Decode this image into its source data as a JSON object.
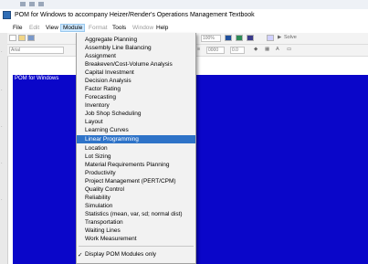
{
  "window": {
    "title": "POM for Windows to accompany Heizer/Render's Operations Management Textbook"
  },
  "menubar": {
    "items": [
      {
        "label": "File",
        "state": "normal"
      },
      {
        "label": "Edit",
        "state": "disabled"
      },
      {
        "label": "View",
        "state": "normal"
      },
      {
        "label": "Module",
        "state": "active"
      },
      {
        "label": "Format",
        "state": "disabled"
      },
      {
        "label": "Tools",
        "state": "normal"
      },
      {
        "label": "Window",
        "state": "disabled"
      },
      {
        "label": "Help",
        "state": "normal"
      }
    ]
  },
  "toolbar": {
    "font_field": "Arial",
    "zoom": "100%",
    "number_format": "0000",
    "decimal": "0.0",
    "solve_label": "Solve"
  },
  "child_window": {
    "title": "POM for Windows"
  },
  "module_menu": {
    "items": [
      "Aggregate Planning",
      "Assembly Line Balancing",
      "Assignment",
      "Breakeven/Cost-Volume Analysis",
      "Capital Investment",
      "Decision Analysis",
      "Factor Rating",
      "Forecasting",
      "Inventory",
      "Job Shop Scheduling",
      "Layout",
      "Learning Curves",
      "Linear Programming",
      "Location",
      "Lot Sizing",
      "Material Requirements Planning",
      "Productivity",
      "Project Management (PERT/CPM)",
      "Quality Control",
      "Reliability",
      "Simulation",
      "Statistics (mean, var, sd; normal dist)",
      "Transportation",
      "Waiting Lines",
      "Work Measurement"
    ],
    "highlighted": "Linear Programming",
    "footer_item": "Display POM Modules only",
    "footer_checked": true
  },
  "colors": {
    "highlight": "#2e73c8",
    "workspace": "#0a06c9"
  }
}
